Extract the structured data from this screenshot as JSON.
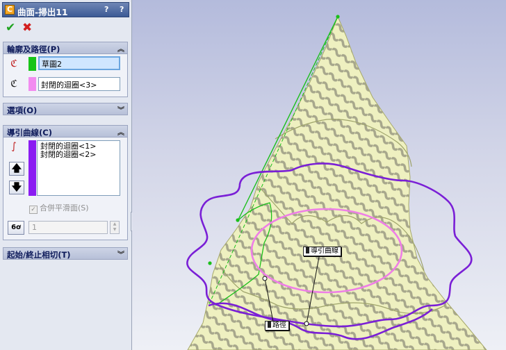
{
  "panel": {
    "title": "曲面-掃出11",
    "help_label": "?",
    "pin_label": "?",
    "ok_label": "✔",
    "cancel_label": "✖"
  },
  "sections": {
    "profile_path": {
      "header": "輪廓及路徑(P)",
      "profile_value": "草圖2",
      "path_value": "封閉的迴圈<3>",
      "profile_color": "#18c418",
      "path_color": "#f28cf0"
    },
    "options": {
      "header": "選項(O)"
    },
    "guide_curves": {
      "header": "導引曲線(C)",
      "items": [
        "封閉的迴圈<1>",
        "封閉的迴圈<2>"
      ],
      "list_color": "#8a1cf2",
      "merge_smooth_label": "合併平滑面(S)",
      "merge_smooth_checked": true,
      "spin_value": "1"
    },
    "start_end": {
      "header": "起始/終止相切(T)"
    }
  },
  "viewport": {
    "callout_guide": "導引曲線",
    "callout_path": "路徑",
    "colors": {
      "guide": "#7a1fd6",
      "path": "#ee7fe6",
      "surface": "#e9ecb3",
      "sketch_green": "#1bbf1b"
    }
  }
}
